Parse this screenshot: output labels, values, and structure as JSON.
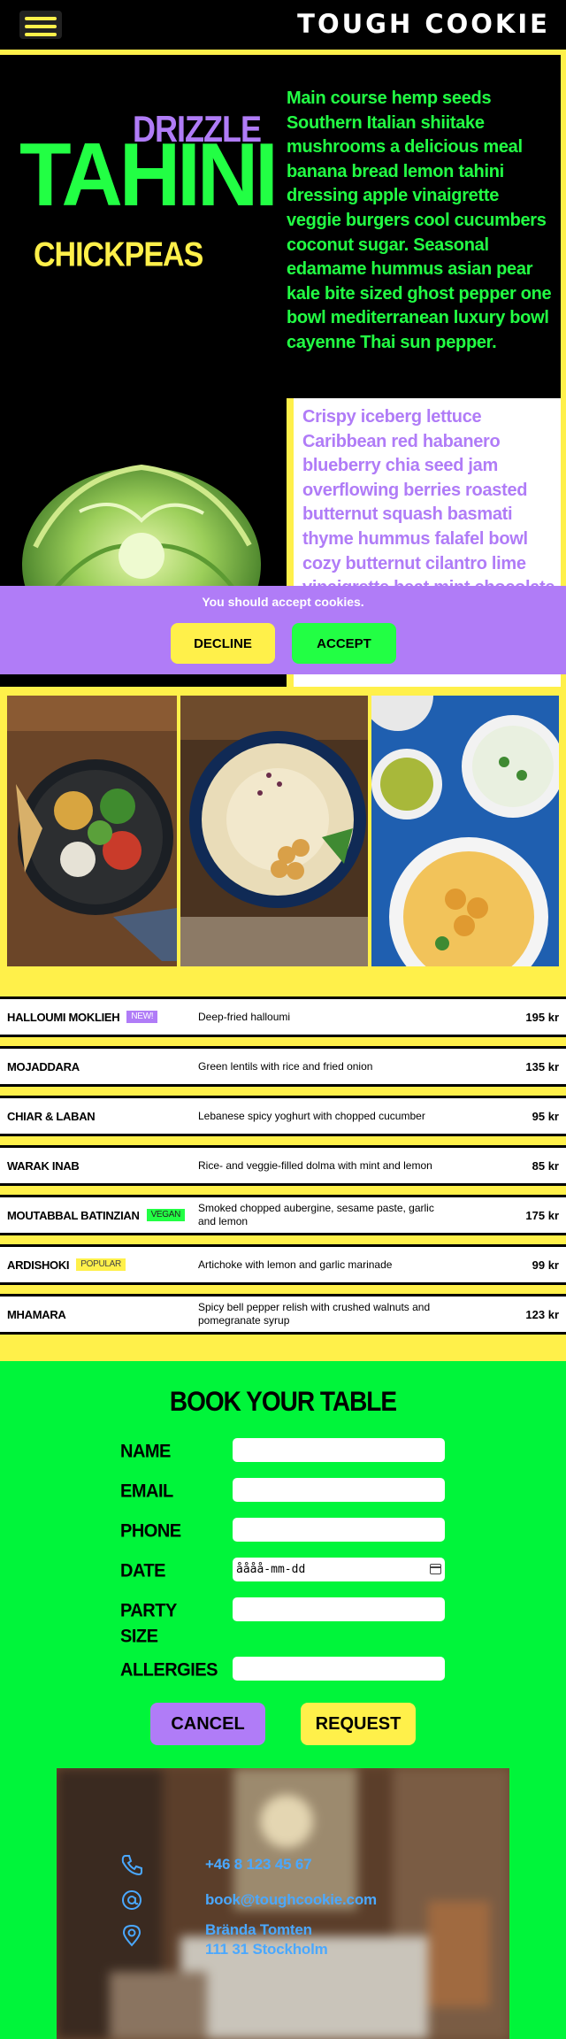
{
  "brand": "TOUGH COOKIE",
  "hero": {
    "title_top": "DRIZZLE",
    "title_main": "TAHINI",
    "title_bottom": "CHICKPEAS",
    "green_text": "Main course hemp seeds Southern Italian shiitake mushrooms a delicious meal banana bread lemon tahini dressing apple vinaigrette veggie burgers cool cucumbers coconut sugar. Seasonal edamame hummus asian pear kale bite sized ghost pepper one bowl mediterranean luxury bowl cayenne Thai sun pepper.",
    "purple_text": "Crispy iceberg lettuce Caribbean red habanero blueberry chia seed jam overflowing berries roasted butternut squash basmati thyme hummus falafel bowl cozy butternut cilantro lime vinaigrette heat mint chocolate chip cookies blackberry"
  },
  "cookie": {
    "message": "You should accept cookies.",
    "decline": "DECLINE",
    "accept": "ACCEPT"
  },
  "menu": [
    {
      "name": "HALLOUMI MOKLIEH",
      "tag": "NEW!",
      "tag_type": "new",
      "desc": "Deep-fried halloumi",
      "price": "195 kr"
    },
    {
      "name": "MOJADDARA",
      "tag": "",
      "tag_type": "",
      "desc": "Green lentils with rice and fried onion",
      "price": "135 kr"
    },
    {
      "name": "CHIAR & LABAN",
      "tag": "",
      "tag_type": "",
      "desc": "Lebanese spicy yoghurt with chopped cucumber",
      "price": "95 kr"
    },
    {
      "name": "WARAK INAB",
      "tag": "",
      "tag_type": "",
      "desc": "Rice- and veggie-filled dolma with mint and lemon",
      "price": "85 kr"
    },
    {
      "name": "MOUTABBAL BATINZIAN",
      "tag": "VEGAN",
      "tag_type": "vegan",
      "desc": "Smoked chopped aubergine, sesame paste, garlic and lemon",
      "price": "175 kr"
    },
    {
      "name": "ARDISHOKI",
      "tag": "POPULAR",
      "tag_type": "popular",
      "desc": "Artichoke with lemon and garlic marinade",
      "price": "99 kr"
    },
    {
      "name": "MHAMARA",
      "tag": "",
      "tag_type": "",
      "desc": "Spicy bell pepper relish with crushed walnuts and pomegranate syrup",
      "price": "123 kr"
    }
  ],
  "booking": {
    "title": "BOOK YOUR TABLE",
    "labels": {
      "name": "NAME",
      "email": "EMAIL",
      "phone": "PHONE",
      "date": "DATE",
      "party_size": "PARTY SIZE",
      "allergies": "ALLERGIES"
    },
    "date_placeholder": "åååå-mm-dd",
    "cancel": "CANCEL",
    "request": "REQUEST"
  },
  "contact": {
    "phone": "+46 8 123 45 67",
    "email": "book@toughcookie.com",
    "address_line1": "Brända Tomten",
    "address_line2": "111 31 Stockholm"
  },
  "icons": [
    "menu-icon",
    "phone-icon",
    "email-icon",
    "location-pin-icon",
    "calendar-icon"
  ],
  "colors": {
    "yellow": "#fff04a",
    "green": "#22ff44",
    "purple": "#b07cf7",
    "link_blue": "#4aa8ff"
  }
}
